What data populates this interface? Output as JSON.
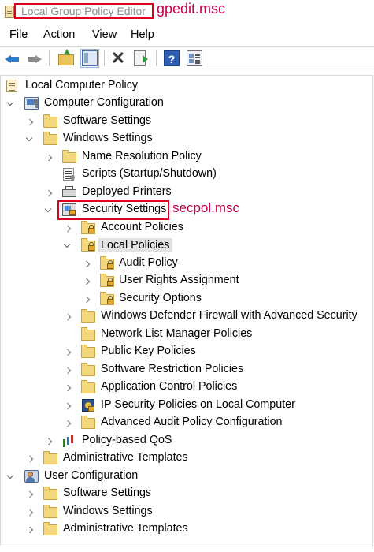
{
  "titlebar": {
    "title": "Local Group Policy Editor",
    "annotation": "gpedit.msc"
  },
  "menu": [
    "File",
    "Action",
    "View",
    "Help"
  ],
  "toolbar": {
    "buttons": [
      "back-icon",
      "forward-icon",
      "up-one-level-icon",
      "show-hide-tree-icon",
      "delete-icon",
      "export-list-icon",
      "help-icon",
      "properties-icon"
    ]
  },
  "tree": {
    "rows": [
      {
        "label": "Local Computer Policy",
        "icon": "document-icon",
        "expander": "none"
      },
      {
        "label": "Computer Configuration",
        "icon": "computer-icon",
        "expander": "expanded"
      },
      {
        "label": "Software Settings",
        "icon": "folder-icon",
        "expander": "collapsed"
      },
      {
        "label": "Windows Settings",
        "icon": "folder-icon",
        "expander": "expanded"
      },
      {
        "label": "Name Resolution Policy",
        "icon": "folder-icon",
        "expander": "collapsed"
      },
      {
        "label": "Scripts (Startup/Shutdown)",
        "icon": "script-icon",
        "expander": "none"
      },
      {
        "label": "Deployed Printers",
        "icon": "printer-icon",
        "expander": "collapsed"
      },
      {
        "label": "Security Settings",
        "icon": "security-settings-icon",
        "expander": "expanded"
      },
      {
        "label": "Account Policies",
        "icon": "locked-folder-icon",
        "expander": "collapsed"
      },
      {
        "label": "Local Policies",
        "icon": "locked-folder-icon",
        "expander": "expanded",
        "selected": true
      },
      {
        "label": "Audit Policy",
        "icon": "locked-folder-icon",
        "expander": "collapsed"
      },
      {
        "label": "User Rights Assignment",
        "icon": "locked-folder-icon",
        "expander": "collapsed"
      },
      {
        "label": "Security Options",
        "icon": "locked-folder-icon",
        "expander": "collapsed"
      },
      {
        "label": "Windows Defender Firewall with Advanced Security",
        "icon": "folder-icon",
        "expander": "collapsed"
      },
      {
        "label": "Network List Manager Policies",
        "icon": "folder-icon",
        "expander": "none"
      },
      {
        "label": "Public Key Policies",
        "icon": "folder-icon",
        "expander": "collapsed"
      },
      {
        "label": "Software Restriction Policies",
        "icon": "folder-icon",
        "expander": "collapsed"
      },
      {
        "label": "Application Control Policies",
        "icon": "folder-icon",
        "expander": "collapsed"
      },
      {
        "label": "IP Security Policies on Local Computer",
        "icon": "ip-security-icon",
        "expander": "collapsed"
      },
      {
        "label": "Advanced Audit Policy Configuration",
        "icon": "folder-icon",
        "expander": "collapsed"
      },
      {
        "label": "Policy-based QoS",
        "icon": "qos-chart-icon",
        "expander": "collapsed"
      },
      {
        "label": "Administrative Templates",
        "icon": "folder-icon",
        "expander": "collapsed"
      },
      {
        "label": "User Configuration",
        "icon": "user-icon",
        "expander": "expanded"
      },
      {
        "label": "Software Settings",
        "icon": "folder-icon",
        "expander": "collapsed"
      },
      {
        "label": "Windows Settings",
        "icon": "folder-icon",
        "expander": "collapsed"
      },
      {
        "label": "Administrative Templates",
        "icon": "folder-icon",
        "expander": "collapsed"
      }
    ]
  },
  "annotations": {
    "security_settings_note": "secpol.msc"
  },
  "colors": {
    "annotation_red": "#e0001b",
    "annotation_text": "#c5004d",
    "selection_bg": "#e3e3e3"
  }
}
